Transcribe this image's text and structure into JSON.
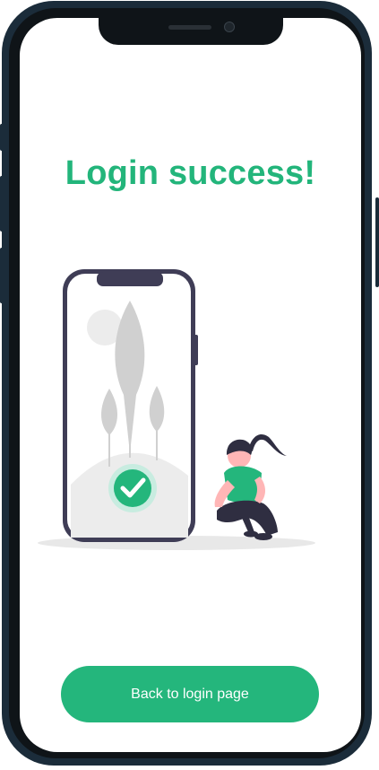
{
  "screen": {
    "title": "Login success!",
    "button_label": "Back to login page"
  },
  "colors": {
    "accent": "#24b67c",
    "title": "#23b57b",
    "phone_frame": "#1b2c3a"
  },
  "icons": [
    "check-icon"
  ]
}
